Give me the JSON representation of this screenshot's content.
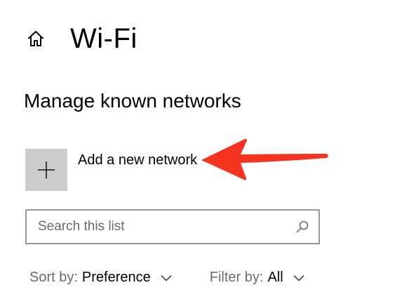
{
  "header": {
    "home_icon": "home-icon",
    "title": "Wi-Fi"
  },
  "section": {
    "title": "Manage known networks"
  },
  "add_network": {
    "icon": "plus-icon",
    "label": "Add a new network"
  },
  "annotation": {
    "icon": "red-arrow-icon",
    "color": "#f5341f"
  },
  "search": {
    "placeholder": "Search this list",
    "value": "",
    "icon": "search-icon"
  },
  "sort": {
    "label": "Sort by:",
    "value": "Preference",
    "icon": "chevron-down-icon"
  },
  "filter": {
    "label": "Filter by:",
    "value": "All",
    "icon": "chevron-down-icon"
  },
  "colors": {
    "tile": "#cccccc",
    "border": "#999999",
    "muted_text": "#6b6b6b"
  }
}
